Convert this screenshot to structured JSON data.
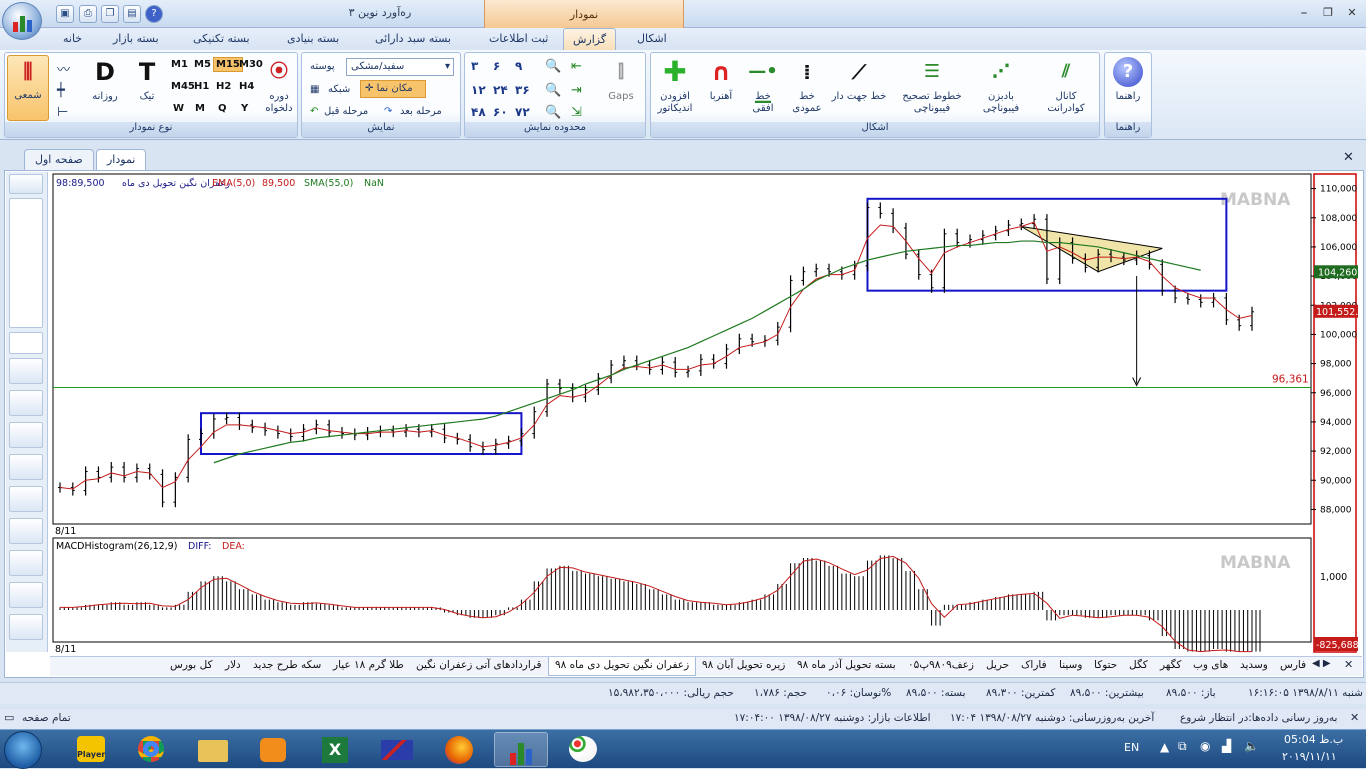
{
  "app": {
    "title": "ره‌آورد نوین ۳",
    "context_tab": "نمودار",
    "win_buttons": [
      "⎯",
      "❐",
      "✕"
    ]
  },
  "ribbon_tabs": [
    "اشکال",
    "گزارش",
    "ثبت اطلاعات",
    "بسته سبد دارائی",
    "بسته بنیادی",
    "بسته تکنیکی",
    "بسته بازار",
    "خانه"
  ],
  "groups": {
    "chart_type": {
      "label": "نوع نمودار",
      "candle": "شمعی",
      "daily": "روزانه",
      "tick": "تیک",
      "period": "دوره\nدلخواه",
      "d": "D",
      "t": "T",
      "tf": [
        "M1",
        "M5",
        "M15",
        "M30",
        "M45",
        "H1",
        "H2",
        "H4",
        "W",
        "M",
        "Q",
        "Y"
      ]
    },
    "display": {
      "label": "نمایش",
      "background_label": "پوسته",
      "background_value": "سفید/مشکی",
      "grid": "شبکه",
      "cursor": "مکان نما",
      "prev": "مرحله قبل",
      "next": "مرحله بعد"
    },
    "range": {
      "label": "محدوده نمایش",
      "items": [
        "۳",
        "۶",
        "۹",
        "۱۲",
        "۲۴",
        "۳۶",
        "۴۸",
        "۶۰",
        "۷۲"
      ],
      "gaps": "Gaps"
    },
    "shapes": {
      "label": "اشکال",
      "items": [
        "افزودن\nاندیکاتور",
        "آهنربا",
        "خط\nافقی",
        "خط\nعمودی",
        "خط جهت دار",
        "خطوط تصحیح\nفیبوناچی",
        "بادبزن\nفیبوناچی",
        "کانال\nکوادرانت"
      ]
    },
    "help": {
      "label": "راهنما",
      "button": "راهنما"
    }
  },
  "doc_tabs": [
    "نمودار",
    "صفحه اول"
  ],
  "chart": {
    "header": {
      "price": "98:89,500",
      "symbol": "زعفران نگین تحویل دی ماه",
      "ema": "EMA(5,0)",
      "ema_val": "89,500",
      "sma": "SMA(55,0)",
      "sma_val": "NaN"
    },
    "watermark": "MABNA",
    "y_ticks": [
      "110,000",
      "108,000",
      "106,000",
      "104,000",
      "102,000",
      "100,000",
      "98,000",
      "96,000",
      "94,000",
      "92,000",
      "90,000",
      "88,000"
    ],
    "y_values": [
      110000,
      108000,
      106000,
      104000,
      102000,
      100000,
      98000,
      96000,
      94000,
      92000,
      90000,
      88000
    ],
    "price_tags": {
      "green": "104,260",
      "red": "101,552.4",
      "level": "96,361"
    },
    "date_label": "8/11",
    "macd": {
      "title": "MACDHistogram(26,12,9)",
      "diff": "DIFF:",
      "dea": "DEA:",
      "tick": "1,000",
      "value": "-825,688"
    },
    "colors": {
      "up": "#000000",
      "ma_fast": "#c41a1a",
      "ma_slow": "#1f7a1f",
      "box": "#1414c8",
      "triangle": "#f0e4a8",
      "level": "#1a9a1a"
    }
  },
  "chart_data": {
    "type": "line",
    "ylim": [
      87000,
      111000
    ],
    "horizontal_level": 96361,
    "close": [
      89500,
      89300,
      90600,
      90200,
      90900,
      90200,
      90800,
      90400,
      88500,
      90200,
      92800,
      93200,
      94200,
      94300,
      93800,
      93600,
      93400,
      93200,
      93000,
      93500,
      93800,
      93300,
      93200,
      93100,
      93300,
      93400,
      93300,
      93500,
      93300,
      93500,
      92900,
      92800,
      92300,
      92100,
      92500,
      92700,
      93200,
      94700,
      96600,
      96300,
      95700,
      96200,
      97000,
      97900,
      98200,
      97900,
      97600,
      98100,
      97400,
      97500,
      98300,
      98000,
      99000,
      99700,
      99500,
      99600,
      100500,
      103700,
      104300,
      104500,
      104300,
      104100,
      104700,
      108700,
      108300,
      107300,
      105500,
      104100,
      103200,
      106900,
      106300,
      106500,
      106800,
      107100,
      107500,
      107600,
      107900,
      103800,
      106300,
      105200,
      104600,
      105500,
      105300,
      105100,
      105400,
      104800,
      103000,
      102500,
      102400,
      102200,
      102500,
      101000,
      100600,
      101550
    ],
    "ema": [
      89500,
      89400,
      90000,
      90100,
      90500,
      90300,
      90600,
      90500,
      89500,
      89900,
      91400,
      92300,
      93300,
      93800,
      93800,
      93700,
      93600,
      93400,
      93200,
      93300,
      93600,
      93400,
      93300,
      93200,
      93200,
      93300,
      93300,
      93400,
      93300,
      93400,
      93100,
      92900,
      92600,
      92300,
      92400,
      92600,
      92900,
      93800,
      95200,
      95800,
      95700,
      95900,
      96500,
      97200,
      97700,
      97800,
      97700,
      97900,
      97600,
      97600,
      97900,
      98000,
      98500,
      99100,
      99300,
      99500,
      100000,
      101900,
      103100,
      103800,
      104100,
      104100,
      104400,
      106600,
      107500,
      107400,
      106400,
      105200,
      104200,
      105600,
      106000,
      106300,
      106600,
      106900,
      107200,
      107400,
      107700,
      105700,
      106000,
      105600,
      105100,
      105300,
      105300,
      105200,
      105300,
      105000,
      104000,
      103200,
      102800,
      102500,
      102500,
      101700,
      101100,
      101300
    ],
    "sma": [
      null,
      null,
      null,
      null,
      null,
      null,
      null,
      null,
      null,
      null,
      null,
      null,
      91200,
      91500,
      91800,
      92000,
      92200,
      92400,
      92600,
      92700,
      92900,
      93000,
      93100,
      93200,
      93300,
      93400,
      93500,
      93600,
      93700,
      93800,
      93900,
      94000,
      94100,
      94200,
      94400,
      94700,
      95000,
      95300,
      95600,
      95900,
      96200,
      96600,
      96900,
      97200,
      97600,
      97900,
      98200,
      98500,
      98800,
      99100,
      99500,
      99900,
      100300,
      100700,
      101100,
      101600,
      102100,
      102600,
      103100,
      103700,
      104100,
      104500,
      104800,
      105100,
      105300,
      105500,
      105700,
      105800,
      105900,
      106000,
      106100,
      106100,
      106200,
      106300,
      106300,
      106400,
      106400,
      106300,
      106300,
      106200,
      106100,
      106000,
      105800,
      105600,
      105400,
      105200,
      105000,
      104800,
      104600,
      104400,
      null,
      null,
      null,
      null
    ],
    "macd_hist": [
      0.05,
      0.05,
      0.1,
      0.1,
      0.15,
      0.1,
      0.15,
      0.1,
      0.05,
      0.1,
      0.35,
      0.55,
      0.65,
      0.55,
      0.4,
      0.3,
      0.2,
      0.15,
      0.1,
      0.15,
      0.12,
      0.1,
      0.05,
      0.05,
      0.05,
      0.05,
      0.05,
      0.05,
      0.05,
      0.05,
      -0.05,
      -0.1,
      -0.15,
      -0.15,
      -0.1,
      0.05,
      0.2,
      0.55,
      0.8,
      0.85,
      0.75,
      0.7,
      0.65,
      0.6,
      0.55,
      0.5,
      0.4,
      0.3,
      0.2,
      0.15,
      0.15,
      0.1,
      0.1,
      0.15,
      0.2,
      0.3,
      0.5,
      0.9,
      1.0,
      0.95,
      0.85,
      0.7,
      0.65,
      0.95,
      1.05,
      1.0,
      0.75,
      0.4,
      -0.3,
      0.1,
      0.1,
      0.15,
      0.2,
      0.25,
      0.3,
      0.3,
      0.35,
      -0.2,
      -0.1,
      -0.1,
      -0.15,
      -0.15,
      -0.1,
      -0.1,
      -0.1,
      -0.2,
      -0.5,
      -0.75,
      -0.8,
      -0.8,
      -0.75,
      -0.8,
      -0.8,
      -0.8
    ],
    "xlabel": "8/11"
  },
  "symbol_tabs": [
    "فارس",
    "وسدید",
    "های وب",
    "کگهر",
    "کگل",
    "حتوکا",
    "وسینا",
    "فاراک",
    "حریل",
    "زعف۹۸۰۹پ۰۵",
    "بسته تحویل آذر ماه ۹۸",
    "زیره تحویل آبان ۹۸",
    "زعفران نگین تحویل دی ماه ۹۸",
    "قراردادهای آتی زعفران نگین",
    "طلا گرم ۱۸ عیار",
    "سکه طرح جدید",
    "دلار",
    "کل بورس"
  ],
  "status": {
    "date": "شنبه ۱۳۹۸/۸/۱۱ ۱۶:۱۶:۰۵",
    "open": "باز: ۸۹،۵۰۰",
    "high": "بیشترین: ۸۹،۵۰۰",
    "low": "کمترین: ۸۹،۳۰۰",
    "close": "بسته: ۸۹،۵۰۰",
    "range": "نوسان: ۰،۰۶%",
    "volume": "حجم: ۱،۷۸۶",
    "value": "حجم ریالی: ۱۵،۹۸۲،۳۵۰،۰۰۰"
  },
  "status2": {
    "update": "به‌روز رسانی داده‌ها:در انتظار شروع",
    "last": "آخرین به‌روزرسانی: دوشنبه ۱۳۹۸/۰۸/۲۷ ۱۷:۰۴",
    "market": "اطلاعات بازار: دوشنبه ۱۳۹۸/۰۸/۲۷ ۱۷:۰۴:۰۰",
    "fullscreen": "تمام صفحه"
  },
  "taskbar": {
    "lang": "EN",
    "time": "05:04 ب.ظ",
    "date": "۲۰۱۹/۱۱/۱۱",
    "apps": [
      "Player",
      "Chrome",
      "Explorer",
      "Media",
      "Excel",
      "Chart",
      "Firefox",
      "Rahavard",
      "Paint"
    ]
  }
}
